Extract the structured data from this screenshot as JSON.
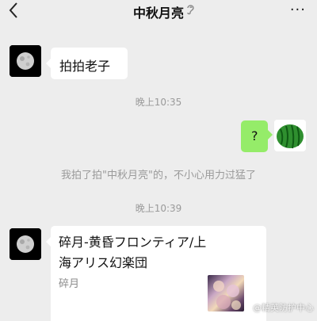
{
  "header": {
    "title": "中秋月亮",
    "back_icon": "chevron-left-icon",
    "mute_icon": "ear-icon",
    "more_label": "···"
  },
  "messages": [
    {
      "type": "incoming",
      "text": "拍拍老子"
    },
    {
      "type": "time",
      "text": "晚上10:35"
    },
    {
      "type": "outgoing",
      "text": "?"
    },
    {
      "type": "system",
      "text": "我拍了拍\"中秋月亮\"的，不小心用力过猛了"
    },
    {
      "type": "time",
      "text": "晚上10:39"
    },
    {
      "type": "incoming-card",
      "title": "碎月-黄昏フロンティア/上海アリス幻楽団",
      "subtitle": "碎月"
    }
  ],
  "watermark": "@精英防护中心",
  "colors": {
    "background": "#ededed",
    "outgoing_bubble": "#95ec69",
    "incoming_bubble": "#ffffff"
  }
}
